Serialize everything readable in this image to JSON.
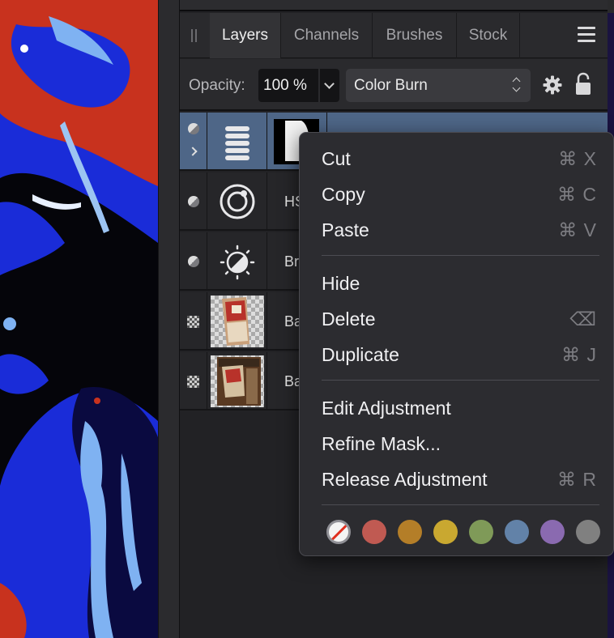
{
  "tabs": [
    {
      "label": "Layers",
      "active": true
    },
    {
      "label": "Channels",
      "active": false
    },
    {
      "label": "Brushes",
      "active": false
    },
    {
      "label": "Stock",
      "active": false
    }
  ],
  "opacity": {
    "label": "Opacity:",
    "value": "100 %"
  },
  "blend_mode": {
    "value": "Color Burn"
  },
  "layers": [
    {
      "name": "",
      "type": "levels-adjustment",
      "selected": true
    },
    {
      "name": "HS",
      "type": "hsl-adjustment",
      "selected": false
    },
    {
      "name": "Br",
      "type": "brightness-contrast-adjustment",
      "selected": false
    },
    {
      "name": "Ba",
      "type": "pixel",
      "selected": false
    },
    {
      "name": "Ba",
      "type": "pixel",
      "selected": false
    }
  ],
  "menu": {
    "groups": [
      [
        {
          "label": "Cut",
          "shortcut": "⌘ X"
        },
        {
          "label": "Copy",
          "shortcut": "⌘ C"
        },
        {
          "label": "Paste",
          "shortcut": "⌘ V"
        }
      ],
      [
        {
          "label": "Hide",
          "shortcut": ""
        },
        {
          "label": "Delete",
          "shortcut": "⌫"
        },
        {
          "label": "Duplicate",
          "shortcut": "⌘ J"
        }
      ],
      [
        {
          "label": "Edit Adjustment",
          "shortcut": ""
        },
        {
          "label": "Refine Mask...",
          "shortcut": ""
        },
        {
          "label": "Release Adjustment",
          "shortcut": "⌘ R"
        }
      ]
    ],
    "tag_colors": [
      "none",
      "#c05a52",
      "#b47e28",
      "#c9a830",
      "#7f9a58",
      "#6282a8",
      "#8a6ab0",
      "#808080"
    ]
  },
  "colors": {
    "selected_row": "#4e6687",
    "panel_bg": "#222225"
  },
  "canvas_colors": {
    "red": "#c8321e",
    "blue": "#1a2cd8",
    "light_blue": "#7fb2f2",
    "black": "#05050a"
  }
}
